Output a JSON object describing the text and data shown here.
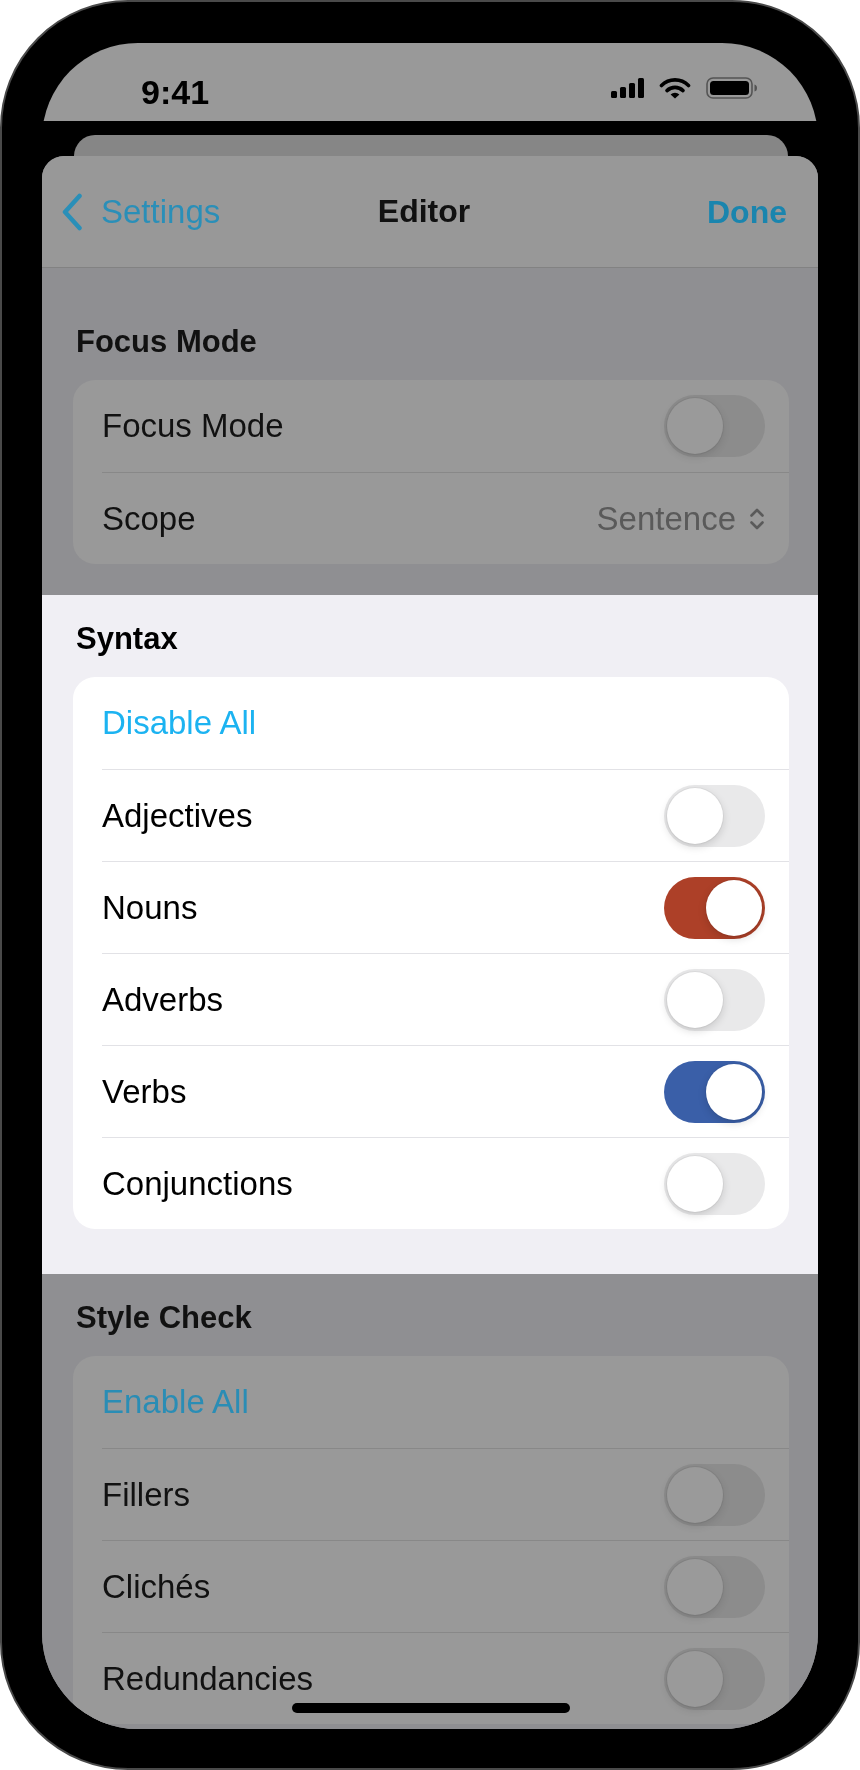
{
  "status_bar": {
    "time": "9:41",
    "dimmed": true
  },
  "nav_bar": {
    "back_label": "Settings",
    "title": "Editor",
    "done_label": "Done",
    "dimmed": true
  },
  "sections": [
    {
      "title": "Focus Mode",
      "dimmed": true,
      "rows": [
        {
          "kind": "toggle",
          "label": "Focus Mode",
          "on": false
        },
        {
          "kind": "picker",
          "label": "Scope",
          "value": "Sentence"
        }
      ]
    },
    {
      "title": "Syntax",
      "dimmed": false,
      "rows": [
        {
          "kind": "action",
          "label": "Disable All"
        },
        {
          "kind": "toggle",
          "label": "Adjectives",
          "on": false
        },
        {
          "kind": "toggle",
          "label": "Nouns",
          "on": true,
          "color": "#ad4028"
        },
        {
          "kind": "toggle",
          "label": "Adverbs",
          "on": false
        },
        {
          "kind": "toggle",
          "label": "Verbs",
          "on": true,
          "color": "#3a5fa8"
        },
        {
          "kind": "toggle",
          "label": "Conjunctions",
          "on": false
        }
      ]
    },
    {
      "title": "Style Check",
      "dimmed": true,
      "rows": [
        {
          "kind": "action",
          "label": "Enable All"
        },
        {
          "kind": "toggle",
          "label": "Fillers",
          "on": false
        },
        {
          "kind": "toggle",
          "label": "Clichés",
          "on": false
        },
        {
          "kind": "toggle",
          "label": "Redundancies",
          "on": false
        }
      ]
    }
  ]
}
